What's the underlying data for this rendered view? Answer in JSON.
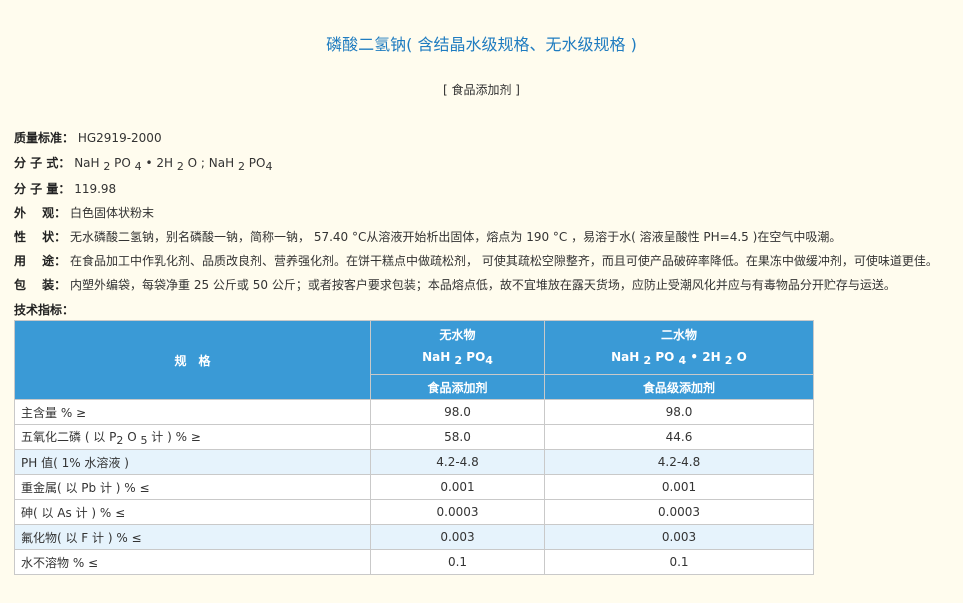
{
  "title": "磷酸二氢钠( 含结晶水级规格、无水级规格 )",
  "subtitle": "[ 食品添加剂 ]",
  "spec": {
    "standard": {
      "label": "质量标准：",
      "value": "HG2919-2000"
    },
    "formula": {
      "label": "分 子 式：",
      "a1": "NaH ",
      "a2": "2",
      "a3": " PO ",
      "a4": "4",
      "a5": " • 2H ",
      "a6": "2",
      "a7": " O ;  NaH ",
      "a8": "2",
      "a9": " PO",
      "a10": "4"
    },
    "weight": {
      "label": "分 子 量：",
      "value": "119.98"
    },
    "appearance": {
      "label": "外　 观：",
      "value": "白色固体状粉末"
    },
    "properties": {
      "label": "性　 状：",
      "value": "无水磷酸二氢钠，别名磷酸一钠，简称一钠， 57.40 °C从溶液开始析出固体，熔点为 190 °C ，易溶于水( 溶液呈酸性 PH=4.5 )在空气中吸潮。"
    },
    "usage": {
      "label": "用　 途：",
      "value": "在食品加工中作乳化剂、品质改良剂、营养强化剂。在饼干糕点中做疏松剂， 可使其疏松空隙整齐，而且可使产品破碎率降低。在果冻中做缓冲剂，可使味道更佳。"
    },
    "packaging": {
      "label": "包　 装：",
      "value": "内塑外编袋，每袋净重 25 公斤或 50 公斤；或者按客户要求包装；本品熔点低，故不宜堆放在露天货场，应防止受潮风化并应与有毒物品分开贮存与运送。"
    }
  },
  "tech_label": "技术指标：",
  "table": {
    "spec_header": "规　格",
    "col1": {
      "name": "无水物",
      "f1": "NaH ",
      "f2": "2",
      "f3": " PO",
      "f4": "4",
      "grade": "食品添加剂"
    },
    "col2": {
      "name": "二水物",
      "f1": "NaH ",
      "f2": "2",
      "f3": " PO ",
      "f4": "4",
      "f5": " • 2H ",
      "f6": "2",
      "f7": " O",
      "grade": "食品级添加剂"
    },
    "rows": [
      {
        "name": "主含量 % ≥",
        "v1": "98.0",
        "v2": "98.0"
      },
      {
        "n1": "五氧化二磷 ( 以 P",
        "n2": "2",
        "n3": " O ",
        "n4": "5",
        "n5": " 计 ) % ≥",
        "v1": "58.0",
        "v2": "44.6"
      },
      {
        "name": "PH 值( 1% 水溶液 )",
        "v1": "4.2-4.8",
        "v2": "4.2-4.8"
      },
      {
        "name": "重金属( 以 Pb 计 ) % ≤",
        "v1": "0.001",
        "v2": "0.001"
      },
      {
        "name": "砷( 以 As 计 ) % ≤",
        "v1": "0.0003",
        "v2": "0.0003"
      },
      {
        "name": "氟化物( 以 F 计 ) % ≤",
        "v1": "0.003",
        "v2": "0.003"
      },
      {
        "name": "水不溶物 % ≤",
        "v1": "0.1",
        "v2": "0.1"
      }
    ]
  }
}
